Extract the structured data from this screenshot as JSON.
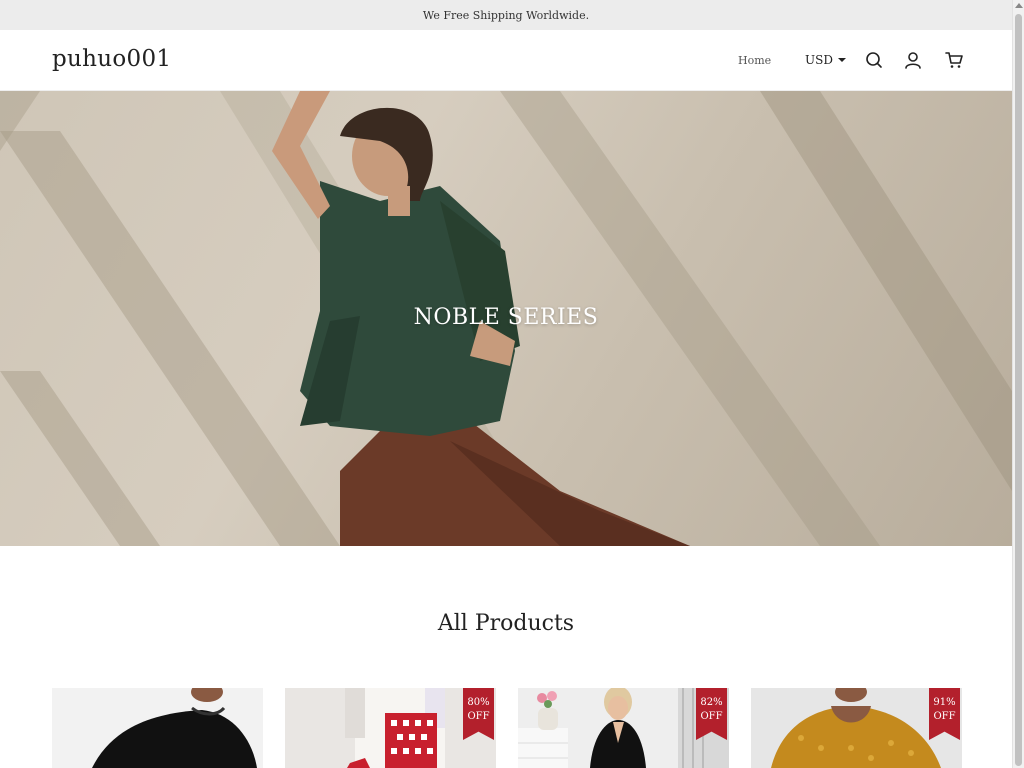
{
  "announcement": "We Free Shipping Worldwide.",
  "header": {
    "logo": "puhuo001",
    "nav_home": "Home",
    "currency": "USD",
    "icons": [
      "search-icon",
      "account-icon",
      "cart-icon"
    ]
  },
  "hero": {
    "title": "NOBLE SERIES"
  },
  "products_section": {
    "title": "All Products",
    "products": [
      {
        "badge_percent": "",
        "badge_off": ""
      },
      {
        "badge_percent": "80%",
        "badge_off": "OFF"
      },
      {
        "badge_percent": "82%",
        "badge_off": "OFF"
      },
      {
        "badge_percent": "91%",
        "badge_off": "OFF"
      }
    ]
  },
  "colors": {
    "announcement_bg": "#ececec",
    "badge": "#b3202c",
    "text": "#222222"
  }
}
